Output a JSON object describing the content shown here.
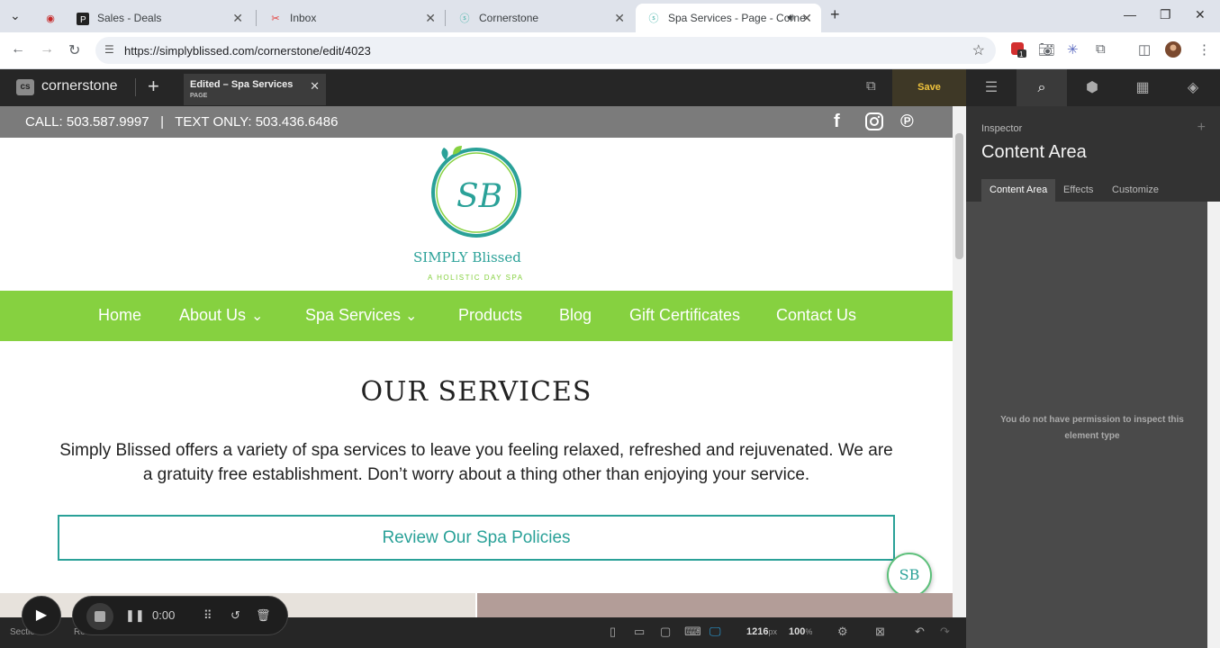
{
  "browser": {
    "tabs": [
      {
        "title": "Sales - Deals"
      },
      {
        "title": "Inbox"
      },
      {
        "title": "Cornerstone"
      },
      {
        "title": "Spa Services - Page - Corne"
      }
    ],
    "url": "https://simplyblissed.com/cornerstone/edit/4023",
    "extension_badge": "1"
  },
  "cornerstone": {
    "brand": "cornerstone",
    "edit_tab_title": "Edited – Spa Services",
    "edit_tab_sub": "PAGE",
    "save_label": "Save"
  },
  "inspector": {
    "label": "Inspector",
    "title": "Content Area",
    "tabs": [
      "Content Area",
      "Effects",
      "Customize"
    ],
    "message": "You do not have permission to inspect this element type"
  },
  "site": {
    "contact_line": "CALL: 503.587.9997   |   TEXT ONLY: 503.436.6486",
    "logo_brand": "SIMPLY Blissed",
    "logo_tagline": "A HOLISTIC DAY SPA",
    "menu": [
      "Home",
      "About Us",
      "Spa Services",
      "Products",
      "Blog",
      "Gift Certificates",
      "Contact Us"
    ],
    "heading": "OUR SERVICES",
    "intro": "Simply Blissed offers a variety of spa services to leave you feeling relaxed, refreshed and rejuvenated. We are a gratuity free establishment. Don’t worry about a thing other than enjoying your service.",
    "policy_button": "Review Our Spa Policies",
    "badge": "SB"
  },
  "bottombar": {
    "crumbs": [
      "Section 2",
      "Ro"
    ],
    "width_value": "1216",
    "width_unit": "px",
    "zoom_value": "100",
    "zoom_unit": "%"
  },
  "recorder": {
    "time": "0:00"
  },
  "colors": {
    "menu_green": "#86d140",
    "teal": "#2aa198",
    "save_yellow": "#f0c33c"
  }
}
